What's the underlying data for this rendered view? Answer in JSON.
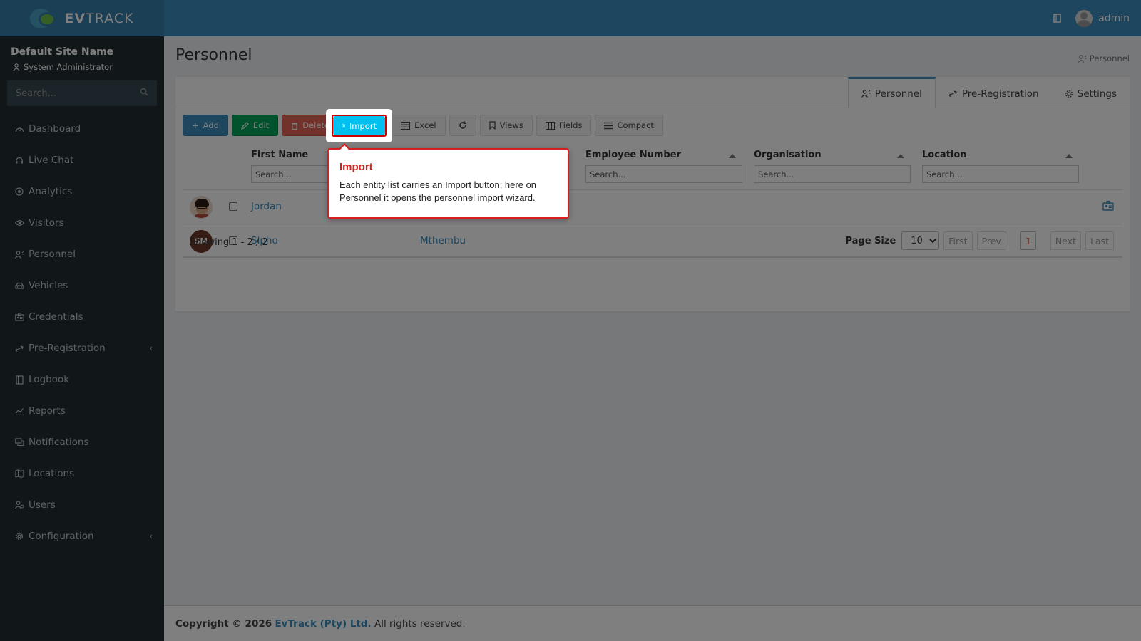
{
  "header": {
    "brand_bold": "EV",
    "brand_rest": "TRACK",
    "user_name": "admin"
  },
  "sidebar": {
    "site_name": "Default Site Name",
    "role": "System Administrator",
    "search_placeholder": "Search...",
    "items": [
      {
        "label": "Dashboard",
        "icon": "dashboard-icon"
      },
      {
        "label": "Live Chat",
        "icon": "headset-icon"
      },
      {
        "label": "Analytics",
        "icon": "target-icon"
      },
      {
        "label": "Visitors",
        "icon": "eye-icon"
      },
      {
        "label": "Personnel",
        "icon": "personnel-icon"
      },
      {
        "label": "Vehicles",
        "icon": "car-icon"
      },
      {
        "label": "Credentials",
        "icon": "id-card-icon"
      },
      {
        "label": "Pre-Registration",
        "icon": "exchange-icon",
        "chevron": "‹"
      },
      {
        "label": "Logbook",
        "icon": "book-icon"
      },
      {
        "label": "Reports",
        "icon": "chart-icon"
      },
      {
        "label": "Notifications",
        "icon": "messages-icon"
      },
      {
        "label": "Locations",
        "icon": "map-icon"
      },
      {
        "label": "Users",
        "icon": "users-icon"
      },
      {
        "label": "Configuration",
        "icon": "gear-icon",
        "chevron": "‹"
      }
    ]
  },
  "page": {
    "title": "Personnel",
    "breadcrumb": "Personnel"
  },
  "tabs": [
    {
      "label": "Personnel",
      "active": true
    },
    {
      "label": "Pre-Registration",
      "active": false
    },
    {
      "label": "Settings",
      "active": false
    }
  ],
  "toolbar": {
    "add": "Add",
    "edit": "Edit",
    "delete": "Delete",
    "import": "Import",
    "excel": "Excel",
    "views": "Views",
    "fields": "Fields",
    "compact": "Compact"
  },
  "grid": {
    "columns": [
      "First Name",
      "Employee Number",
      "Organisation",
      "Location"
    ],
    "filter_placeholder": "Search...",
    "rows": [
      {
        "first_name": "Jordan",
        "last_name": "",
        "avatar": "photo"
      },
      {
        "first_name": "Sipho",
        "last_name": "Mthembu",
        "avatar": "initials",
        "initials": "SM"
      }
    ]
  },
  "pager": {
    "showing": "Showing 1 - 2 / 2",
    "page_size_label": "Page Size",
    "page_size": "10",
    "first": "First",
    "prev": "Prev",
    "current": "1",
    "next": "Next",
    "last": "Last"
  },
  "footer": {
    "copyright": "Copyright © 2026",
    "company": "EvTrack (Pty) Ltd.",
    "rights": "All rights reserved."
  },
  "tour": {
    "title": "Import",
    "body": "Each entity list carries an Import button; here on Personnel it opens the personnel import wizard."
  },
  "colors": {
    "header": "#3c8dbc",
    "sidebar": "#222d32",
    "accent": "#3c8dbc",
    "tour_border": "#d62020"
  }
}
